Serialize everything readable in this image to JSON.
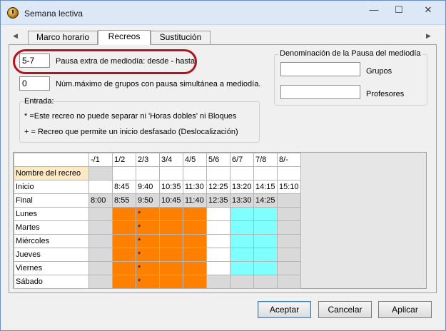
{
  "window": {
    "title": "Semana lectiva",
    "minimize": "—",
    "maximize": "☐",
    "close": "✕"
  },
  "tabs": [
    {
      "label": "Marco horario"
    },
    {
      "label": "Recreos"
    },
    {
      "label": "Sustitución"
    }
  ],
  "tab_arrows": {
    "left": "◀",
    "right": "▶"
  },
  "pause": {
    "range_value": "5-7",
    "range_label": "Pausa extra de mediodía: desde - hasta.",
    "max_groups_value": "0",
    "max_groups_label": "Núm.máximo de grupos con pausa simultánea a mediodía."
  },
  "entrada": {
    "title": "Entrada:",
    "line1": "* =Este recreo no puede separar ni 'Horas dobles' ni Bloques",
    "line2": "+ = Recreo que permite un inicio desfasado (Deslocalización)"
  },
  "denominacion": {
    "title": "Denominación de la Pausa del mediodía",
    "grupos_label": "Grupos",
    "grupos_value": "",
    "profesores_label": "Profesores",
    "profesores_value": ""
  },
  "grid": {
    "columns": [
      "-/1",
      "1/2",
      "2/3",
      "3/4",
      "4/5",
      "5/6",
      "6/7",
      "7/8",
      "8/-"
    ],
    "nombre_label": "Nombre del recreo",
    "inicio_label": "Inicio",
    "inicio": [
      "",
      "8:45",
      "9:40",
      "10:35",
      "11:30",
      "12:25",
      "13:20",
      "14:15",
      "15:10"
    ],
    "final_label": "Final",
    "final": [
      "8:00",
      "8:55",
      "9:50",
      "10:45",
      "11:40",
      "12:35",
      "13:30",
      "14:25",
      ""
    ],
    "days": [
      "Lunes",
      "Martes",
      "Miércoles",
      "Jueves",
      "Viernes",
      "Sábado"
    ],
    "star_mark": "*",
    "colors": {
      "orange": "#ff7f00",
      "cyan": "#80ffff",
      "grey": "#d9d9d9",
      "tan": "#fde8c4"
    }
  },
  "buttons": {
    "accept": "Aceptar",
    "cancel": "Cancelar",
    "apply": "Aplicar"
  }
}
